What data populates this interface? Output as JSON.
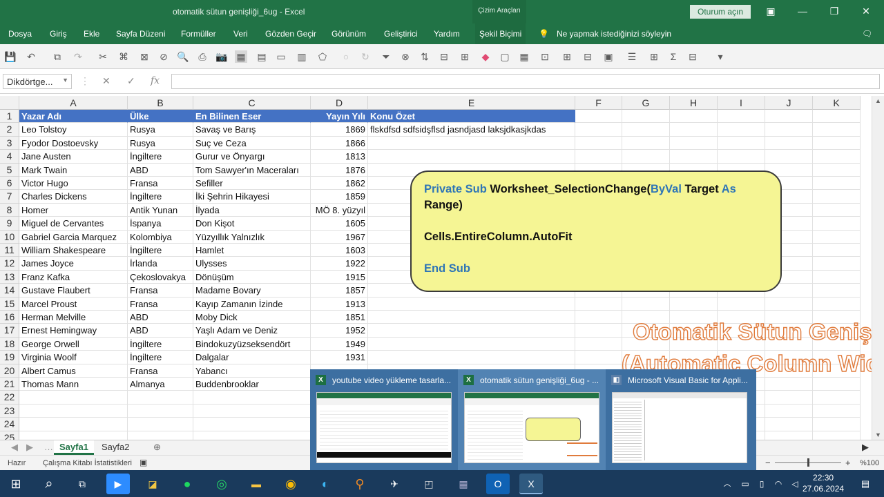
{
  "window": {
    "title": "otomatik sütun genişliği_6ug  -  Excel",
    "context_tab": "Çizim Araçları",
    "signin_label": "Oturum açın"
  },
  "menu": {
    "items": [
      "Dosya",
      "Giriş",
      "Ekle",
      "Sayfa Düzeni",
      "Formüller",
      "Veri",
      "Gözden Geçir",
      "Görünüm",
      "Geliştirici",
      "Yardım",
      "Şekil Biçimi"
    ],
    "active": "Şekil Biçimi",
    "tell_me": "Ne yapmak istediğinizi söyleyin"
  },
  "formula_bar": {
    "name_box": "Dikdörtge...",
    "fx_label": "fx",
    "cancel_glyph": "✕",
    "enter_glyph": "✓",
    "value": ""
  },
  "columns": [
    "A",
    "B",
    "C",
    "D",
    "E",
    "F",
    "G",
    "H",
    "I",
    "J",
    "K"
  ],
  "row_numbers": [
    "1",
    "2",
    "3",
    "4",
    "5",
    "6",
    "7",
    "8",
    "9",
    "10",
    "11",
    "12",
    "13",
    "14",
    "15",
    "16",
    "17",
    "18",
    "19",
    "20",
    "21",
    "22",
    "23",
    "24",
    "25"
  ],
  "header_row": [
    "Yazar Adı",
    "Ülke",
    "En Bilinen Eser",
    "Yayın Yılı",
    "Konu Özet"
  ],
  "rows": [
    [
      "Leo Tolstoy",
      "Rusya",
      "Savaş ve Barış",
      "1869",
      "flskdfsd  sdfsidşflsd  jasndjasd laksjdkasjkdas"
    ],
    [
      "Fyodor Dostoevsky",
      "Rusya",
      "Suç ve Ceza",
      "1866",
      ""
    ],
    [
      "Jane Austen",
      "İngiltere",
      "Gurur ve Önyargı",
      "1813",
      ""
    ],
    [
      "Mark Twain",
      "ABD",
      "Tom Sawyer'ın Maceraları",
      "1876",
      ""
    ],
    [
      "Victor Hugo",
      "Fransa",
      "Sefiller",
      "1862",
      ""
    ],
    [
      "Charles Dickens",
      "İngiltere",
      "İki Şehrin Hikayesi",
      "1859",
      ""
    ],
    [
      "Homer",
      "Antik Yunan",
      "İlyada",
      "MÖ 8. yüzyıl",
      ""
    ],
    [
      "Miguel de Cervantes",
      "İspanya",
      "Don Kişot",
      "1605",
      ""
    ],
    [
      "Gabriel Garcia Marquez",
      "Kolombiya",
      "Yüzyıllık Yalnızlık",
      "1967",
      ""
    ],
    [
      "William Shakespeare",
      "İngiltere",
      "Hamlet",
      "1603",
      ""
    ],
    [
      "James Joyce",
      "İrlanda",
      "Ulysses",
      "1922",
      ""
    ],
    [
      "Franz Kafka",
      "Çekoslovakya",
      "Dönüşüm",
      "1915",
      ""
    ],
    [
      "Gustave Flaubert",
      "Fransa",
      "Madame Bovary",
      "1857",
      ""
    ],
    [
      "Marcel Proust",
      "Fransa",
      "Kayıp Zamanın İzinde",
      "1913",
      ""
    ],
    [
      "Herman Melville",
      "ABD",
      "Moby Dick",
      "1851",
      ""
    ],
    [
      "Ernest Hemingway",
      "ABD",
      "Yaşlı Adam ve Deniz",
      "1952",
      ""
    ],
    [
      "George Orwell",
      "İngiltere",
      "Bindokuzyüzseksendört",
      "1949",
      ""
    ],
    [
      "Virginia Woolf",
      "İngiltere",
      "Dalgalar",
      "1931",
      ""
    ],
    [
      "Albert Camus",
      "Fransa",
      "Yabancı",
      "",
      ""
    ],
    [
      "Thomas Mann",
      "Almanya",
      "Buddenbrooklar",
      "",
      ""
    ]
  ],
  "vba_shape": {
    "line1_kw1": "Private Sub",
    "line1_txt": " Worksheet_SelectionChange(",
    "line1_kw2": "ByVal",
    "line1_txt2": " Target ",
    "line1_kw3": "As",
    "line2": "Range)",
    "line3": "Cells.EntireColumn.AutoFit",
    "line4": "End Sub"
  },
  "watermark": {
    "line1": "Otomatik Sütun Geniş",
    "line2": "(Automatic Column Wid"
  },
  "sheet_tabs": [
    "Sayfa1",
    "Sayfa2"
  ],
  "active_sheet": "Sayfa1",
  "status": {
    "ready": "Hazır",
    "stats": "Çalışma Kitabı İstatistikleri",
    "zoom": "%100"
  },
  "thumbnails": [
    {
      "title": "youtube video yükleme tasarla..."
    },
    {
      "title": "otomatik sütun genişliği_6ug - ..."
    },
    {
      "title": "Microsoft Visual Basic for Appli..."
    }
  ],
  "taskbar": {
    "time": "22:30",
    "date": "27.06.2024"
  },
  "colors": {
    "excel_green": "#217346",
    "header_fill": "#4472c4",
    "vba_keyword": "#2e75b6",
    "shape_fill": "#f5f594",
    "watermark_stroke": "#e07b3c"
  }
}
